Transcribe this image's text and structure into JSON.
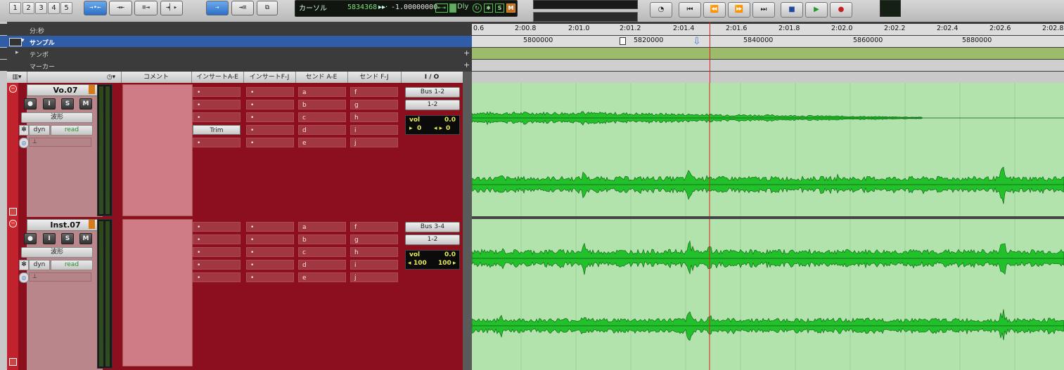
{
  "toolbar": {
    "zoom_presets": [
      "1",
      "2",
      "3",
      "4",
      "5"
    ],
    "mode_buttons": [
      {
        "icon": "shuffle-icon",
        "glyph": "→•←"
      },
      {
        "icon": "spot-icon",
        "glyph": "⇥⇤"
      },
      {
        "icon": "slip-icon",
        "glyph": "≡⇥"
      },
      {
        "icon": "grid-icon",
        "glyph": "⇥▏▸"
      }
    ],
    "tool_buttons": [
      {
        "icon": "smart-tool-icon",
        "glyph": "⇢"
      },
      {
        "icon": "link-icon",
        "glyph": "⇥≡"
      },
      {
        "icon": "window-icon",
        "glyph": "⧉"
      }
    ]
  },
  "counter": {
    "label": "カーソル",
    "position": "5834368",
    "scrub_value": "-1.00000000",
    "dly_label": "Dly",
    "buttons": [
      "S",
      "M"
    ]
  },
  "transport": {
    "buttons": [
      {
        "name": "online-icon",
        "glyph": "◔"
      },
      {
        "name": "return-to-zero-icon",
        "glyph": "⏮"
      },
      {
        "name": "rewind-icon",
        "glyph": "⏪"
      },
      {
        "name": "fast-forward-icon",
        "glyph": "⏩"
      },
      {
        "name": "go-to-end-icon",
        "glyph": "⏭"
      },
      {
        "name": "stop-icon",
        "glyph": "■"
      },
      {
        "name": "play-icon",
        "glyph": "▶"
      },
      {
        "name": "record-icon",
        "glyph": "●"
      }
    ]
  },
  "rulers": {
    "minsec_label": "分:秒",
    "minsec_ticks": [
      "0.6",
      "2:00.8",
      "2:01.0",
      "2:01.2",
      "2:01.4",
      "2:01.6",
      "2:01.8",
      "2:02.0",
      "2:02.2",
      "2:02.4",
      "2:02.6",
      "2:02.8"
    ],
    "samples_label": "サンプル",
    "sample_ticks": [
      "5800000",
      "5820000",
      "5840000",
      "5860000",
      "5880000"
    ],
    "tempo_label": "テンポ",
    "marker_label": "マーカー"
  },
  "columns": {
    "comment": "コメント",
    "inserts_ae": "インサートA-E",
    "inserts_fj": "インサートF-J",
    "sends_ae": "センド A-E",
    "sends_fj": "センド F-J",
    "io": "I / O"
  },
  "tracks": [
    {
      "name": "Vo.07",
      "view": "波形",
      "automation_mode": "read",
      "dyn_label": "dyn",
      "buttons": [
        "●",
        "I",
        "S",
        "M"
      ],
      "inserts_ae": [
        "•",
        "•",
        "•",
        "Trim",
        "•"
      ],
      "inserts_fj": [
        "•",
        "•",
        "•",
        "•",
        "•"
      ],
      "sends_ae": [
        "a",
        "b",
        "c",
        "d",
        "e"
      ],
      "sends_fj": [
        "f",
        "g",
        "h",
        "i",
        "j"
      ],
      "output_bus": "Bus 1-2",
      "input": "1-2",
      "vol_label": "vol",
      "vol_value": "0.0",
      "pan_left": "0",
      "pan_right": "0"
    },
    {
      "name": "Inst.07",
      "view": "波形",
      "automation_mode": "read",
      "dyn_label": "dyn",
      "buttons": [
        "●",
        "I",
        "S",
        "M"
      ],
      "inserts_ae": [
        "•",
        "•",
        "•",
        "•",
        "•"
      ],
      "inserts_fj": [
        "•",
        "•",
        "•",
        "•",
        "•"
      ],
      "sends_ae": [
        "a",
        "b",
        "c",
        "d",
        "e"
      ],
      "sends_fj": [
        "f",
        "g",
        "h",
        "i",
        "j"
      ],
      "output_bus": "Bus 3-4",
      "input": "1-2",
      "vol_label": "vol",
      "vol_value": "0.0",
      "pan_left": "100",
      "pan_right": "100"
    }
  ],
  "colors": {
    "track_red": "#8b0f1c",
    "waveform_bg": "#b2e3ad",
    "waveform": "#22c02a",
    "playhead": "#e02020",
    "tempo_bar": "#9dbb6c"
  }
}
